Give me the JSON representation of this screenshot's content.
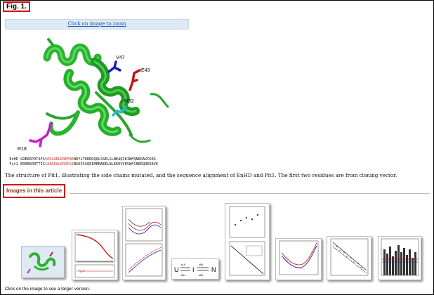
{
  "figure": {
    "label": "Fig. 1.",
    "zoom_link": "Click on image to zoom",
    "residue_labels": {
      "v47": "V47",
      "e43": "E43",
      "m32": "M32",
      "r18": "R18"
    },
    "colors": {
      "helix": "#29b42e",
      "v47": "#1c1cb4",
      "e43": "#c01818",
      "m32": "#1fb8d6",
      "r18": "#c81ec8",
      "sequence_highlight": "#d22222"
    }
  },
  "sequence_alignment": {
    "rows": [
      {
        "name": "EnHD",
        "parts": [
          {
            "text": "GDEKRPRTAFS",
            "highlight": false
          },
          {
            "text": "SEQLARLKREFNE",
            "highlight": true
          },
          {
            "text": "NRYLTERRRQQLSSELGLNEAQIKIWFQNKRAKIKRS-",
            "highlight": false
          }
        ]
      },
      {
        "name": "Pit1",
        "parts": [
          {
            "text": "ERRRKRRTTIS",
            "highlight": false
          },
          {
            "text": "IAARDALERSFGE",
            "highlight": true
          },
          {
            "text": "NSKPSSQEIMRMAEELNLEKEVVRVWFCNRRQREKRVK",
            "highlight": false
          }
        ]
      }
    ]
  },
  "caption": "The structure of Pit1, illustrating the side chains mutated, and the sequence alignment of EnHD and Pit1. The first two residues are from cloning vector.",
  "images_section": {
    "title": "Images in this article",
    "footer": "Click on the image to see a larger version.",
    "scheme_labels": {
      "u": "U",
      "i": "I",
      "n": "N",
      "k_ui": "kUI",
      "k_iu": "kIU",
      "k_in": "kIN",
      "k_ni": "kNI"
    }
  }
}
